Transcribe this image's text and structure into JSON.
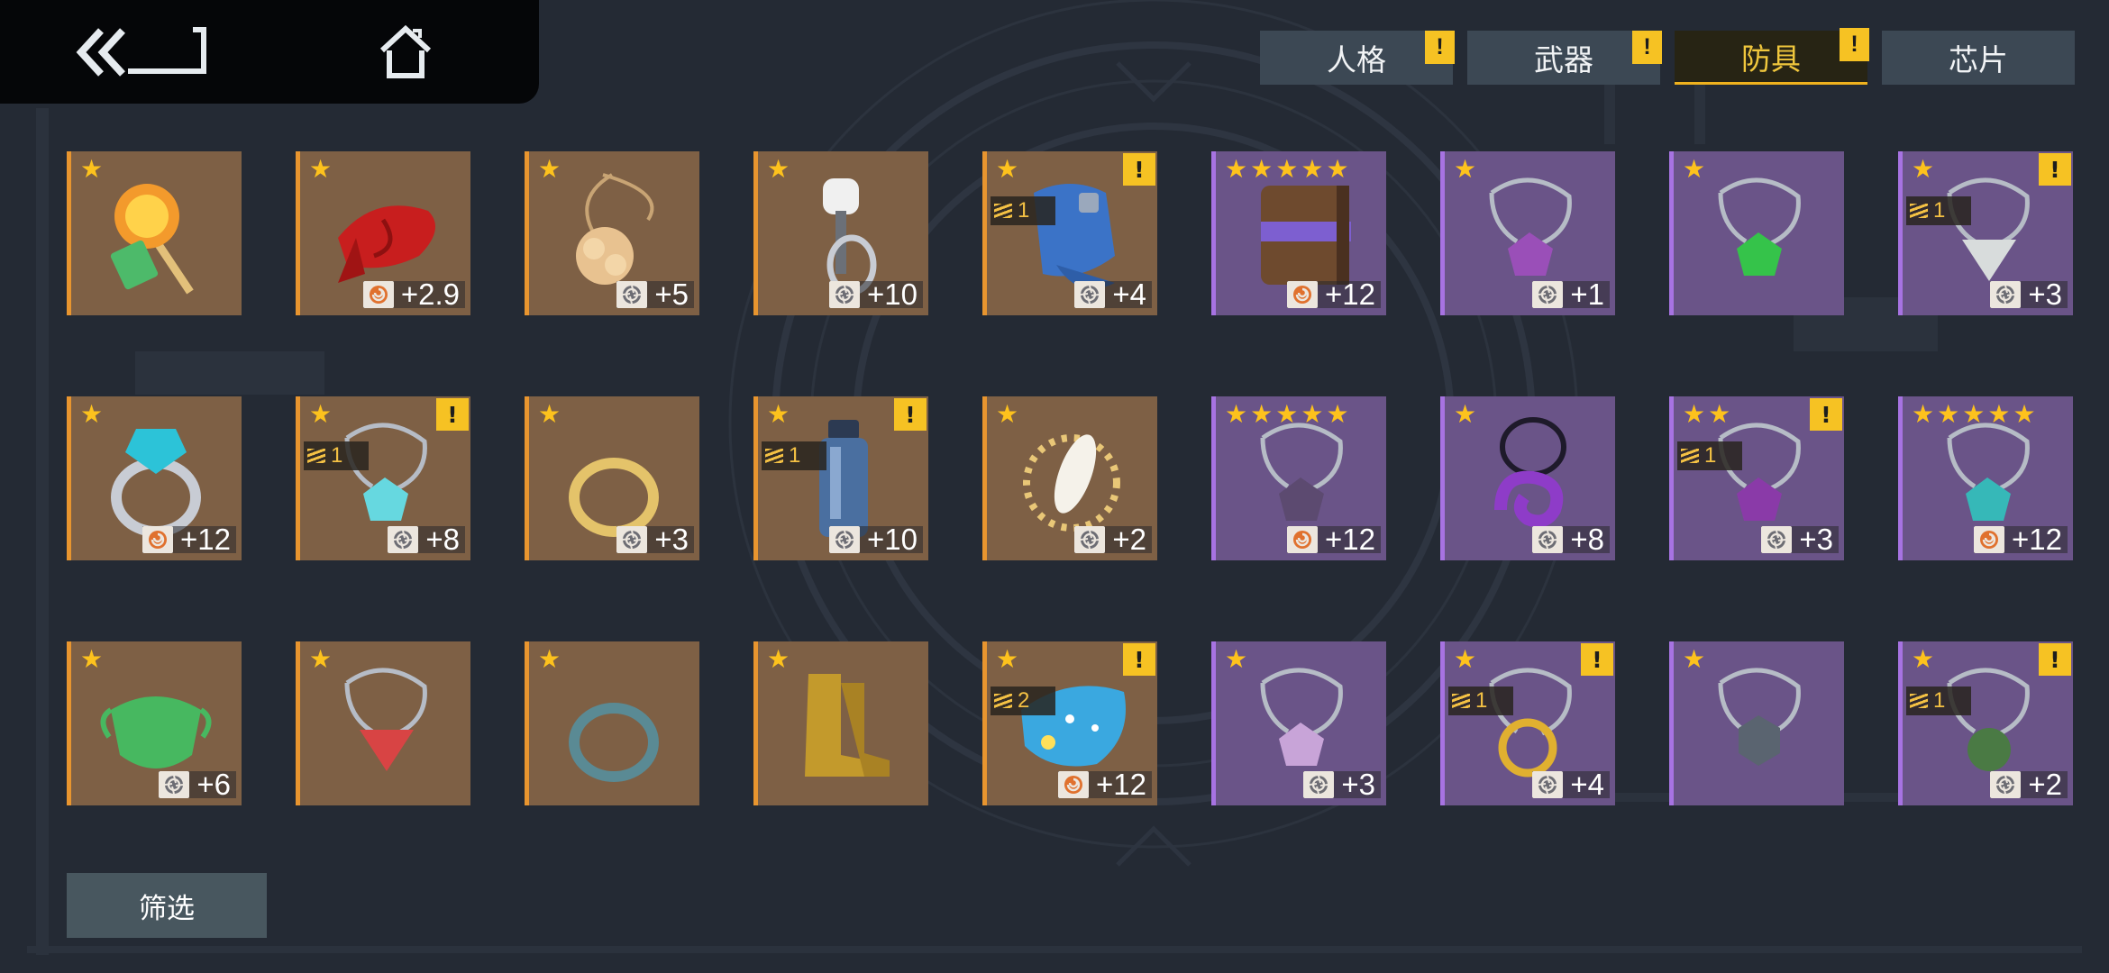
{
  "tabs": [
    {
      "label": "人格",
      "alert": "!",
      "active": false
    },
    {
      "label": "武器",
      "alert": "!",
      "active": false
    },
    {
      "label": "防具",
      "alert": "!",
      "active": true
    },
    {
      "label": "芯片",
      "alert": "",
      "active": false
    }
  ],
  "filter_label": "筛选",
  "colors": {
    "gold_border": "#e8952f",
    "purple_border": "#a773e2",
    "star": "#fdc21d",
    "active_tab": "#f0c73d"
  },
  "items": [
    {
      "rarity": "gold",
      "stars": 1,
      "alert": "",
      "stack": "",
      "chip": "",
      "level": "",
      "icon": "lollipop-icon",
      "color": "#f39a2c"
    },
    {
      "rarity": "gold",
      "stars": 1,
      "alert": "",
      "stack": "",
      "chip": "spiral",
      "level": "+2.9",
      "icon": "red-scarf-icon",
      "color": "#c81e1e"
    },
    {
      "rarity": "gold",
      "stars": 1,
      "alert": "",
      "stack": "",
      "chip": "shutter",
      "level": "+5",
      "icon": "flower-pendant-icon",
      "color": "#e8c290"
    },
    {
      "rarity": "gold",
      "stars": 1,
      "alert": "",
      "stack": "",
      "chip": "shutter",
      "level": "+10",
      "icon": "keyring-icon",
      "color": "#c8ccd4"
    },
    {
      "rarity": "gold",
      "stars": 1,
      "alert": "!",
      "stack": "1",
      "chip": "shutter",
      "level": "+4",
      "icon": "gloves-icon",
      "color": "#3b73c7"
    },
    {
      "rarity": "purple",
      "stars": 5,
      "alert": "",
      "stack": "",
      "chip": "spiral",
      "level": "+12",
      "icon": "book-icon",
      "color": "#6e4a2e"
    },
    {
      "rarity": "purple",
      "stars": 1,
      "alert": "",
      "stack": "",
      "chip": "shutter",
      "level": "+1",
      "icon": "amethyst-necklace-icon",
      "color": "#9a4fb8"
    },
    {
      "rarity": "purple",
      "stars": 1,
      "alert": "",
      "stack": "",
      "chip": "",
      "level": "",
      "icon": "emerald-necklace-icon",
      "color": "#35c34a"
    },
    {
      "rarity": "purple",
      "stars": 1,
      "alert": "!",
      "stack": "1",
      "chip": "shutter",
      "level": "+3",
      "icon": "triangle-pendant-icon",
      "color": "#d8dcdc"
    },
    {
      "rarity": "gold",
      "stars": 1,
      "alert": "",
      "stack": "",
      "chip": "spiral",
      "level": "+12",
      "icon": "gem-ring-icon",
      "color": "#2cc3d8"
    },
    {
      "rarity": "gold",
      "stars": 1,
      "alert": "!",
      "stack": "1",
      "chip": "shutter",
      "level": "+8",
      "icon": "crystal-necklace-icon",
      "color": "#66d8e0"
    },
    {
      "rarity": "gold",
      "stars": 1,
      "alert": "",
      "stack": "",
      "chip": "shutter",
      "level": "+3",
      "icon": "gold-ring-icon",
      "color": "#e4c36a"
    },
    {
      "rarity": "gold",
      "stars": 1,
      "alert": "!",
      "stack": "1",
      "chip": "shutter",
      "level": "+10",
      "icon": "bottle-icon",
      "color": "#4a6fa0"
    },
    {
      "rarity": "gold",
      "stars": 1,
      "alert": "",
      "stack": "",
      "chip": "shutter",
      "level": "+2",
      "icon": "sun-feather-icon",
      "color": "#e9c777"
    },
    {
      "rarity": "purple",
      "stars": 5,
      "alert": "",
      "stack": "",
      "chip": "spiral",
      "level": "+12",
      "icon": "dark-crystal-necklace-icon",
      "color": "#5c4a70"
    },
    {
      "rarity": "purple",
      "stars": 1,
      "alert": "",
      "stack": "",
      "chip": "shutter",
      "level": "+8",
      "icon": "spiral-pendant-icon",
      "color": "#8e3cc8"
    },
    {
      "rarity": "purple",
      "stars": 2,
      "alert": "!",
      "stack": "1",
      "chip": "shutter",
      "level": "+3",
      "icon": "purple-gem-necklace-icon",
      "color": "#8a3aa8"
    },
    {
      "rarity": "purple",
      "stars": 5,
      "alert": "",
      "stack": "",
      "chip": "spiral",
      "level": "+12",
      "icon": "teal-crystal-necklace-icon",
      "color": "#36b8b8"
    },
    {
      "rarity": "gold",
      "stars": 1,
      "alert": "",
      "stack": "",
      "chip": "shutter",
      "level": "+6",
      "icon": "face-mask-icon",
      "color": "#47b860"
    },
    {
      "rarity": "gold",
      "stars": 1,
      "alert": "",
      "stack": "",
      "chip": "",
      "level": "",
      "icon": "red-heart-pendant-icon",
      "color": "#d84444"
    },
    {
      "rarity": "gold",
      "stars": 1,
      "alert": "",
      "stack": "",
      "chip": "",
      "level": "",
      "icon": "band-ring-icon",
      "color": "#5a8a94"
    },
    {
      "rarity": "gold",
      "stars": 1,
      "alert": "",
      "stack": "",
      "chip": "",
      "level": "",
      "icon": "boots-icon",
      "color": "#c39a2c"
    },
    {
      "rarity": "gold",
      "stars": 1,
      "alert": "!",
      "stack": "2",
      "chip": "spiral",
      "level": "+12",
      "icon": "starry-cloth-icon",
      "color": "#3aa8e0"
    },
    {
      "rarity": "purple",
      "stars": 1,
      "alert": "",
      "stack": "",
      "chip": "shutter",
      "level": "+3",
      "icon": "lilac-pendant-icon",
      "color": "#c8a4d8"
    },
    {
      "rarity": "purple",
      "stars": 1,
      "alert": "!",
      "stack": "1",
      "chip": "shutter",
      "level": "+4",
      "icon": "gold-ring-necklace-icon",
      "color": "#e0b030"
    },
    {
      "rarity": "purple",
      "stars": 1,
      "alert": "",
      "stack": "",
      "chip": "",
      "level": "",
      "icon": "hexagon-pendant-icon",
      "color": "#5a6470"
    },
    {
      "rarity": "purple",
      "stars": 1,
      "alert": "!",
      "stack": "1",
      "chip": "shutter",
      "level": "+2",
      "icon": "green-orb-necklace-icon",
      "color": "#4a7a44"
    }
  ]
}
